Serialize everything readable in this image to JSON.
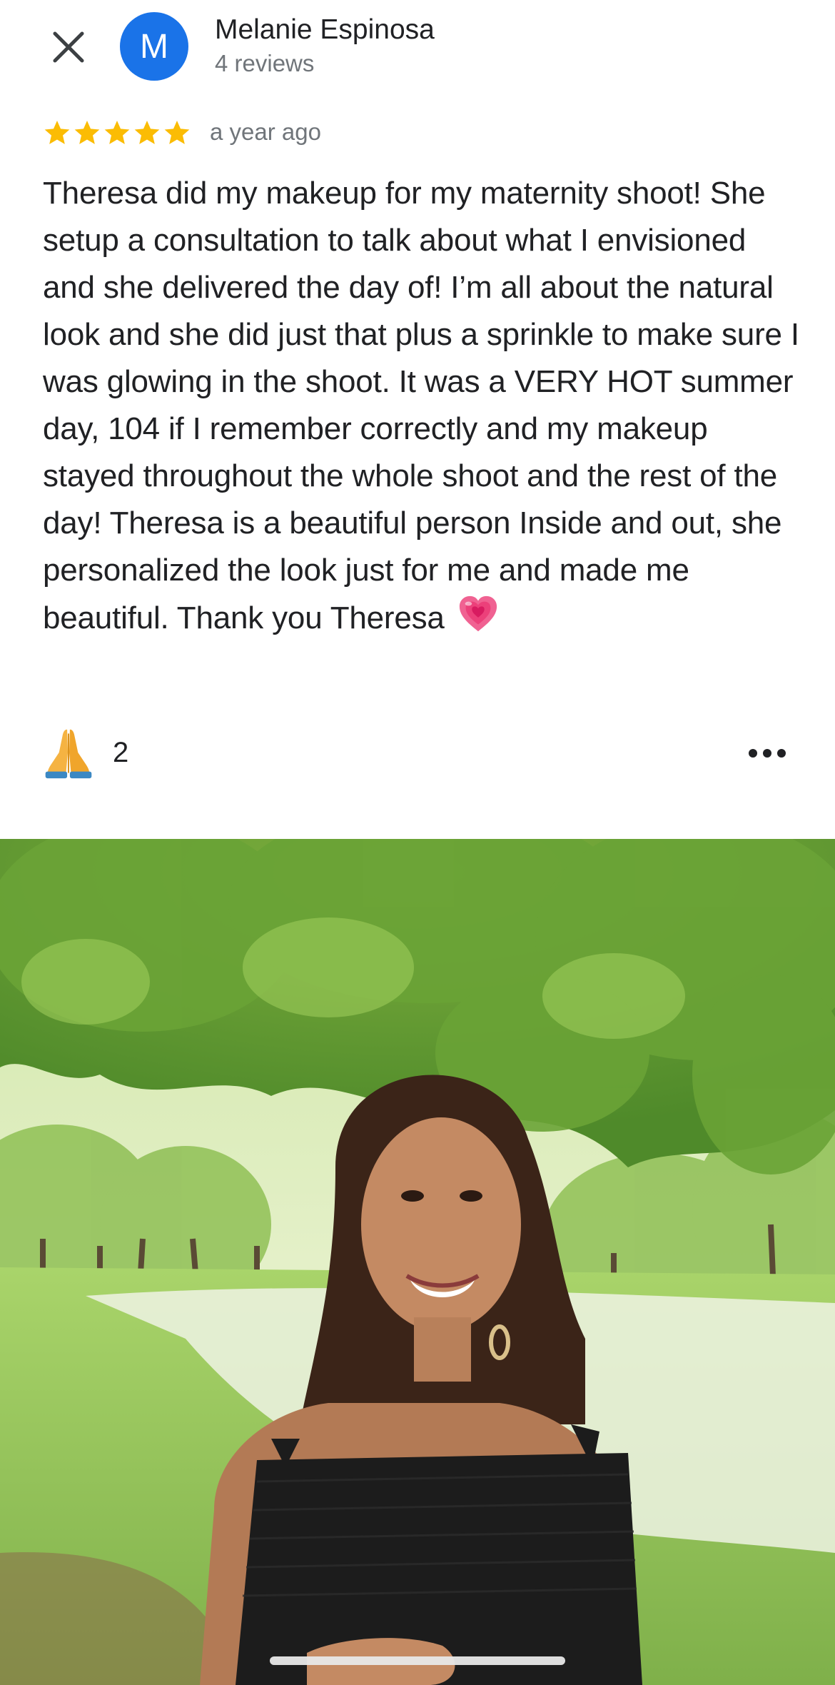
{
  "header": {
    "close_icon": "close-icon",
    "avatar_letter": "M",
    "avatar_color": "#1a73e8",
    "reviewer_name": "Melanie Espinosa",
    "reviewer_meta": "4 reviews"
  },
  "review": {
    "rating": 5,
    "rating_max": 5,
    "star_color": "#fbbc04",
    "time": "a year ago",
    "text": "Theresa did my makeup for my maternity shoot! She setup a consultation to talk about what I envisioned and she delivered the day of! I’m all about the natural look and she did just that plus a sprinkle to make sure I was glowing in the shoot. It was a VERY HOT summer day, 104 if I remember  correctly and my makeup stayed throughout the whole shoot and the rest of the day! Theresa is a beautiful person Inside and out, she personalized the look just for me and made me beautiful. Thank you Theresa",
    "text_emoji": "growing-heart-icon"
  },
  "reactions": {
    "icon": "praying-hands-icon",
    "count": "2",
    "more_icon": "more-options-icon"
  },
  "photo": {
    "subject": "review-photo"
  }
}
